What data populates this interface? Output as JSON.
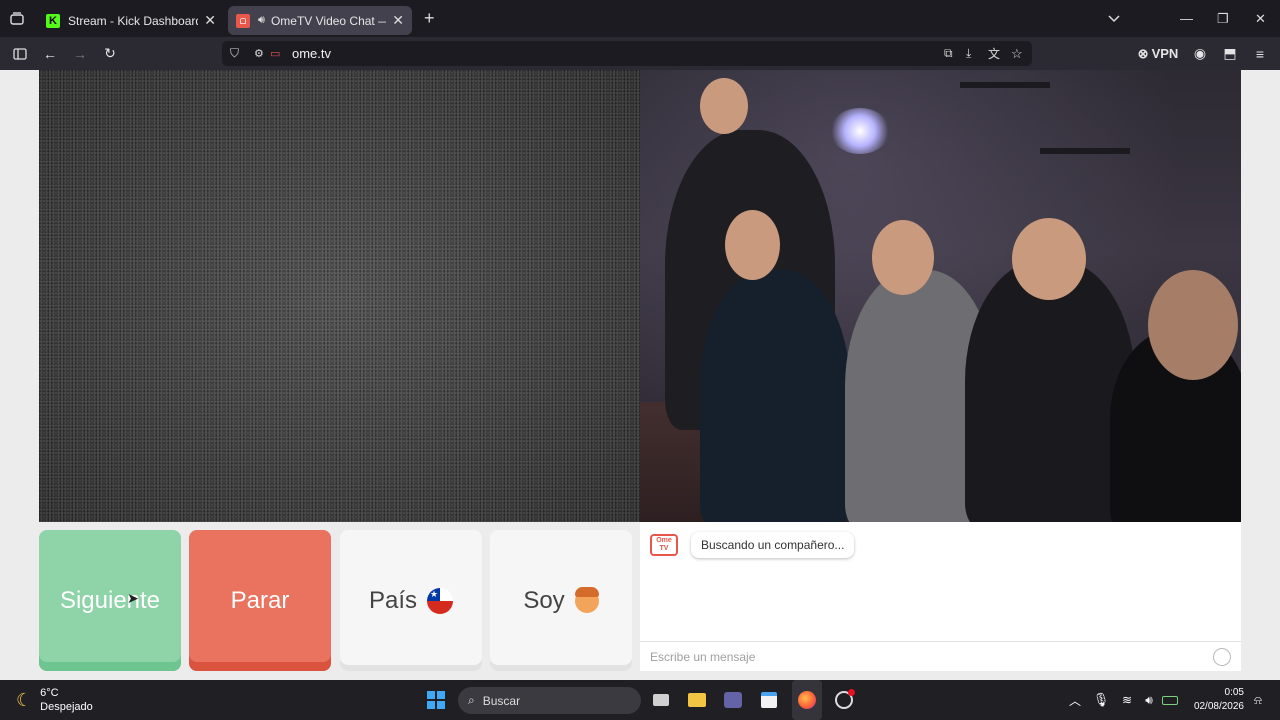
{
  "browser": {
    "tabs": [
      {
        "title": "Stream - Kick Dashboard",
        "favicon": "kick-icon",
        "active": false
      },
      {
        "title": "OmeTV Video Chat — Ome",
        "favicon": "ometv-icon",
        "active": true
      }
    ],
    "url": "ome.tv",
    "vpn_label": "VPN"
  },
  "controls": {
    "next_label": "Siguiente",
    "stop_label": "Parar",
    "country_label": "País",
    "gender_label": "Soy"
  },
  "chat": {
    "logo_text": "Ome TV",
    "status_message": "Buscando un compañero...",
    "input_placeholder": "Escribe un mensaje"
  },
  "taskbar": {
    "weather_temp": "6°C",
    "weather_desc": "Despejado",
    "search_label": "Buscar",
    "time": "0:05",
    "date": "02/08/2026"
  },
  "colors": {
    "next": "#8fd3a9",
    "stop": "#e9735e",
    "brand": "#e8574a"
  }
}
